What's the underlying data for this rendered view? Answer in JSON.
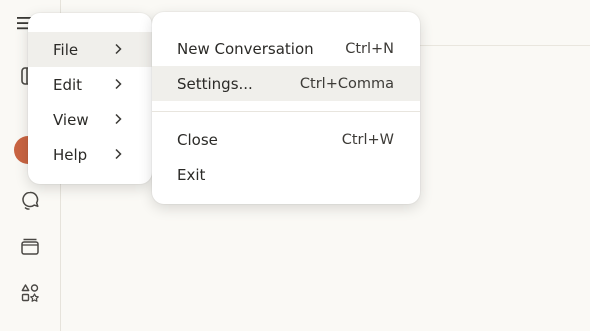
{
  "main_menu": {
    "items": [
      {
        "label": "File"
      },
      {
        "label": "Edit"
      },
      {
        "label": "View"
      },
      {
        "label": "Help"
      }
    ]
  },
  "file_submenu": {
    "items": [
      {
        "label": "New Conversation",
        "shortcut": "Ctrl+N"
      },
      {
        "label": "Settings...",
        "shortcut": "Ctrl+Comma"
      },
      {
        "label": "Close",
        "shortcut": "Ctrl+W"
      },
      {
        "label": "Exit",
        "shortcut": ""
      }
    ]
  },
  "rail": {
    "icons": [
      "menu-icon",
      "sidebar-toggle-icon",
      "new-chat-icon",
      "chats-icon",
      "projects-icon",
      "artifacts-icon"
    ],
    "accent": "#c96442"
  }
}
